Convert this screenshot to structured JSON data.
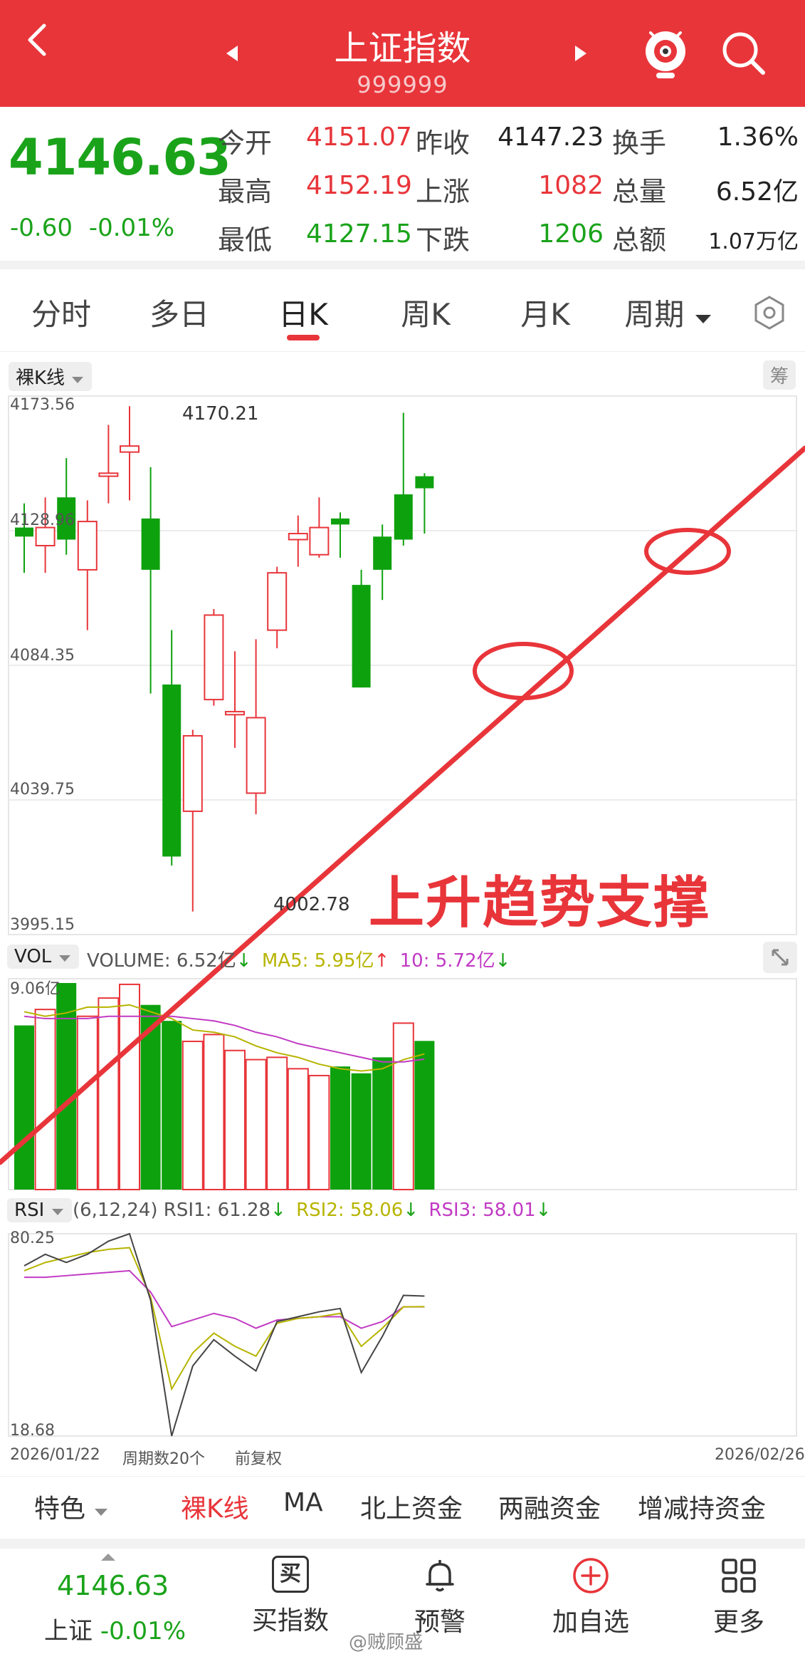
{
  "header": {
    "title": "上证指数",
    "code": "999999"
  },
  "quote": {
    "price": "4146.63",
    "change": "-0.60",
    "change_pct": "-0.01%",
    "rows": [
      {
        "l1": "今开",
        "v1": "4151.07",
        "c1": "red",
        "l2": "昨收",
        "v2": "4147.23",
        "c2": "blk",
        "l3": "换手",
        "v3": "1.36%",
        "c3": "blk"
      },
      {
        "l1": "最高",
        "v1": "4152.19",
        "c1": "red",
        "l2": "上涨",
        "v2": "1082",
        "c2": "red",
        "l3": "总量",
        "v3": "6.52亿",
        "c3": "blk"
      },
      {
        "l1": "最低",
        "v1": "4127.15",
        "c1": "green",
        "l2": "下跌",
        "v2": "1206",
        "c2": "green",
        "l3": "总额",
        "v3": "1.07万亿",
        "c3": "blk"
      }
    ]
  },
  "tabs": [
    "分时",
    "多日",
    "日K",
    "周K",
    "月K",
    "周期"
  ],
  "kline": {
    "indicator_label": "裸K线",
    "chip_label": "筹",
    "y_labels": [
      "4173.56",
      "4128.96",
      "4084.35",
      "4039.75",
      "3995.15"
    ],
    "high_label": "4170.21",
    "low_label": "4002.78",
    "annotation": "上升趋势支撑",
    "colors": {
      "up": "#e8353a",
      "down": "#0ea10e",
      "trend": "#e8353a"
    }
  },
  "volume": {
    "label": "VOL",
    "max_label": "9.06亿",
    "legend_volume": "VOLUME: 6.52亿",
    "legend_ma5": "MA5: 5.95亿",
    "legend_ma10": "10: 5.72亿",
    "arrow_down": "↓",
    "arrow_up": "↑"
  },
  "rsi": {
    "label": "RSI",
    "params": "(6,12,24)",
    "legend_rsi1": "RSI1: 61.28",
    "legend_rsi2": "RSI2: 58.06",
    "legend_rsi3": "RSI3: 58.01",
    "arrow_down": "↓",
    "max_label": "80.25",
    "min_label": "18.68",
    "date_start": "2026/01/22",
    "period_count": "周期数20个",
    "adjust": "前复权",
    "date_end": "2026/02/26"
  },
  "bottom_tabs": [
    "特色",
    "裸K线",
    "MA",
    "北上资金",
    "两融资金",
    "增减持资金"
  ],
  "footer": {
    "price": "4146.63",
    "name": "上证",
    "pct": "-0.01%",
    "buy_icon_char": "买",
    "items": [
      "买指数",
      "预警",
      "加自选",
      "更多"
    ],
    "watermark": "@贼顾盛"
  },
  "chart_data": {
    "type": "candlestick",
    "dates": [
      "2026/01/22",
      "2026/02/26"
    ],
    "period_count": 20,
    "ylim": [
      3995.15,
      4173.56
    ],
    "y_ticks": [
      4173.56,
      4128.96,
      4084.35,
      4039.75,
      3995.15
    ],
    "candles": [
      {
        "o": 4130,
        "c": 4127,
        "h": 4138,
        "l": 4115
      },
      {
        "o": 4124,
        "c": 4130,
        "h": 4140,
        "l": 4115
      },
      {
        "o": 4140,
        "c": 4126,
        "h": 4153,
        "l": 4121
      },
      {
        "o": 4116,
        "c": 4132,
        "h": 4139,
        "l": 4096
      },
      {
        "o": 4147,
        "c": 4148,
        "h": 4164,
        "l": 4138
      },
      {
        "o": 4155,
        "c": 4157,
        "h": 4170.21,
        "l": 4139
      },
      {
        "o": 4133,
        "c": 4116,
        "h": 4150,
        "l": 4075
      },
      {
        "o": 4078,
        "c": 4021,
        "h": 4096,
        "l": 4018
      },
      {
        "o": 4036,
        "c": 4061,
        "h": 4063,
        "l": 4002.78
      },
      {
        "o": 4073,
        "c": 4101,
        "h": 4103,
        "l": 4071
      },
      {
        "o": 4068,
        "c": 4069,
        "h": 4089,
        "l": 4057
      },
      {
        "o": 4042,
        "c": 4067,
        "h": 4093,
        "l": 4035
      },
      {
        "o": 4096,
        "c": 4115,
        "h": 4117,
        "l": 4090
      },
      {
        "o": 4126,
        "c": 4128,
        "h": 4134,
        "l": 4117
      },
      {
        "o": 4121,
        "c": 4130,
        "h": 4140,
        "l": 4120
      },
      {
        "o": 4133,
        "c": 4131,
        "h": 4135,
        "l": 4120
      },
      {
        "o": 4111,
        "c": 4077,
        "h": 4116,
        "l": 4077
      },
      {
        "o": 4127,
        "c": 4116,
        "h": 4131,
        "l": 4106
      },
      {
        "o": 4141,
        "c": 4126,
        "h": 4168,
        "l": 4124
      },
      {
        "o": 4147,
        "c": 4143,
        "h": 4148,
        "l": 4128
      }
    ],
    "volume": {
      "ylim": [
        0,
        9.06
      ],
      "unit": "亿",
      "values": [
        7.2,
        7.9,
        9.06,
        7.6,
        8.4,
        9.0,
        8.1,
        7.4,
        6.5,
        6.8,
        6.1,
        5.7,
        5.8,
        5.3,
        5.0,
        5.4,
        5.1,
        5.8,
        7.3,
        6.52
      ],
      "up": [
        false,
        true,
        false,
        true,
        true,
        true,
        false,
        false,
        true,
        true,
        true,
        true,
        true,
        true,
        true,
        false,
        false,
        false,
        true,
        false
      ],
      "ma5": [
        7.8,
        7.6,
        7.75,
        8.0,
        8.0,
        8.1,
        7.8,
        7.5,
        7.0,
        6.9,
        6.7,
        6.3,
        6.0,
        5.8,
        5.5,
        5.3,
        5.2,
        5.3,
        5.7,
        5.95
      ],
      "ma10": [
        7.6,
        7.5,
        7.5,
        7.5,
        7.6,
        7.6,
        7.6,
        7.6,
        7.5,
        7.4,
        7.2,
        6.9,
        6.7,
        6.4,
        6.2,
        6.0,
        5.8,
        5.6,
        5.6,
        5.72
      ]
    },
    "rsi": {
      "ylim": [
        18.68,
        80.25
      ],
      "rsi1": [
        70.5,
        74.0,
        71.5,
        74.0,
        78.0,
        80.25,
        60.0,
        18.68,
        40.0,
        48.0,
        43.0,
        38.5,
        53.5,
        55.0,
        56.5,
        57.5,
        38.0,
        49.0,
        61.5,
        61.28
      ],
      "rsi2": [
        69.0,
        71.5,
        73.0,
        74.5,
        75.5,
        76.0,
        61.0,
        33.0,
        44.0,
        50.0,
        46.0,
        43.0,
        53.0,
        54.5,
        55.0,
        56.0,
        46.0,
        51.5,
        58.0,
        58.06
      ],
      "rsi3": [
        67.0,
        67.0,
        67.5,
        68.0,
        68.5,
        69.0,
        62.5,
        52.0,
        54.0,
        56.0,
        54.5,
        51.5,
        54.0,
        54.5,
        55.0,
        55.0,
        51.5,
        53.5,
        58.0,
        58.01
      ]
    }
  }
}
